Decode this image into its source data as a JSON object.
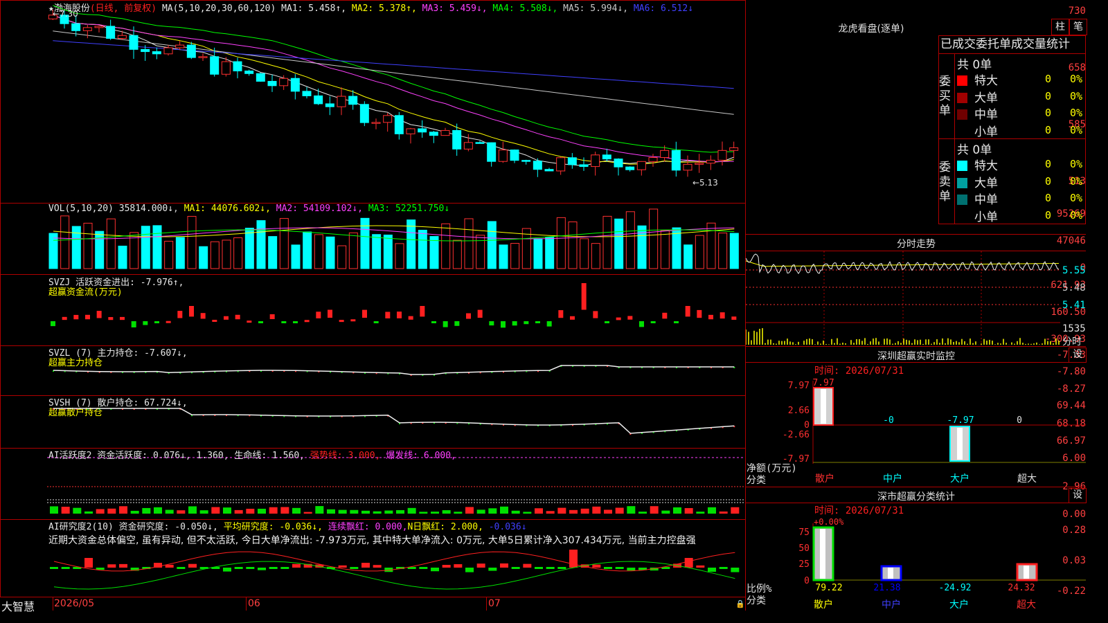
{
  "main": {
    "title": "★渤海股份",
    "period": "(日线, 前复权)",
    "ma_label": "MA(5,10,20,30,60,120)",
    "ma": [
      {
        "name": "MA1:",
        "value": "5.458↑",
        "color": "#e8e8e8"
      },
      {
        "name": "MA2:",
        "value": "5.378↑",
        "color": "#ffff00"
      },
      {
        "name": "MA3:",
        "value": "5.459↓",
        "color": "#ff40ff"
      },
      {
        "name": "MA4:",
        "value": "5.508↓",
        "color": "#00ff00"
      },
      {
        "name": "MA5:",
        "value": "5.994↓",
        "color": "#c8c8c8"
      },
      {
        "name": "MA6:",
        "value": "6.512↓",
        "color": "#4040ff"
      }
    ],
    "y_ticks": [
      "730",
      "658",
      "585",
      "513"
    ],
    "high_label": "←7.30",
    "low_label": "←5.13"
  },
  "vol": {
    "label": "VOL(5,10,20)",
    "value": "35814.000↓",
    "ma": [
      {
        "name": "MA1:",
        "value": "44076.602↓",
        "color": "#ffff00"
      },
      {
        "name": "MA2:",
        "value": "54109.102↓",
        "color": "#ff40ff"
      },
      {
        "name": "MA3:",
        "value": "52251.750↓",
        "color": "#00ff00"
      }
    ],
    "y_ticks": [
      "95269",
      "47046",
      "0"
    ]
  },
  "svzj": {
    "line1": "SVZJ  活跃资金进出: -7.976↑,",
    "line2": "超赢资金流(万元)",
    "y_ticks": [
      "621.93",
      "160.50",
      "-300.93"
    ]
  },
  "svzl": {
    "line1": "SVZL (7) 主力持仓: -7.607↓,",
    "line2": "超赢主力持仓",
    "y_ticks": [
      "-7.33",
      "-7.80",
      "-8.27"
    ]
  },
  "svsh": {
    "line1": "SVSH (7) 散户持仓: 67.724↓,",
    "line2": "超赢散户持仓",
    "y_ticks": [
      "69.44",
      "68.18",
      "66.97"
    ]
  },
  "ai1": {
    "prefix": "AI活跃度2 资金活跃度: 0.076↓, 1.360, 生命线: 1.560,",
    "strong": "强势线: 3.000,",
    "burst": "爆发线: 6.000,",
    "y_ticks": [
      "6.00",
      "2.96",
      "0.00"
    ]
  },
  "ai2": {
    "prefix": "AI研究度2(10) 资金研究度: -0.050↓,",
    "avg": "平均研究度: -0.036↓,",
    "red": "连续飘红: 0.000,",
    "nred": "N日飘红: 2.000,",
    "tail": "-0.036↓",
    "comment": "近期大资金总体偏空, 虽有异动, 但不太活跃, 今日大单净流出: -7.973万元, 其中特大单净流入: 0万元, 大单5日累计净入307.434万元, 当前主力控盘强",
    "y_ticks": [
      "0.28",
      "0.03",
      "-0.22"
    ]
  },
  "date_axis": {
    "corner": "大智慧",
    "labels": [
      "2026/05",
      "06",
      "07"
    ]
  },
  "lhb": {
    "title": "龙虎看盘(逐单)",
    "btn_zhu": "柱",
    "btn_bi": "笔",
    "tabs": "已成交委托单成交量统计",
    "buy_label": "委买单",
    "sell_label": "委卖单",
    "buy_total": "共 0单",
    "sell_total": "共 0单",
    "buy_rows": [
      {
        "name": "特大",
        "count": "0",
        "pct": "0%",
        "color": "#ff0000"
      },
      {
        "name": "大单",
        "count": "0",
        "pct": "0%",
        "color": "#a00000"
      },
      {
        "name": "中单",
        "count": "0",
        "pct": "0%",
        "color": "#700000"
      },
      {
        "name": "小单",
        "count": "0",
        "pct": "0%",
        "color": "#000000"
      }
    ],
    "sell_rows": [
      {
        "name": "特大",
        "count": "0",
        "pct": "0%",
        "color": "#00ffff"
      },
      {
        "name": "大单",
        "count": "0",
        "pct": "0%",
        "color": "#00a0a0"
      },
      {
        "name": "中单",
        "count": "0",
        "pct": "0%",
        "color": "#007070"
      },
      {
        "name": "小单",
        "count": "0",
        "pct": "0%",
        "color": "#000000"
      }
    ]
  },
  "fenshi": {
    "title": "分时走势",
    "price_ticks": [
      "5.55",
      "5.48",
      "5.41"
    ],
    "vol_top": "1535",
    "vol_unit": "分时"
  },
  "sz_monitor": {
    "title": "深圳超赢实时监控",
    "btn": "设",
    "time": "时间: 2026/07/31",
    "y_ticks": [
      "7.97",
      "2.66",
      "0",
      "-2.66",
      "-7.97"
    ],
    "unit1": "净额(万元)",
    "unit2": "分类",
    "bar_values": [
      "7.97",
      "-0",
      "-7.97",
      "0"
    ],
    "categories": [
      "散户",
      "中户",
      "大户",
      "超大"
    ]
  },
  "sz_stats": {
    "title": "深市超赢分类统计",
    "btn": "设",
    "time": "时间: 2026/07/31",
    "top_value": "+0.00%",
    "y_ticks": [
      "75",
      "50",
      "25",
      "0"
    ],
    "unit1": "比例%",
    "unit2": "分类",
    "bar_values": [
      "79.22",
      "21.38",
      "-24.92",
      "24.32"
    ],
    "categories": [
      "散户",
      "中户",
      "大户",
      "超大"
    ]
  }
}
